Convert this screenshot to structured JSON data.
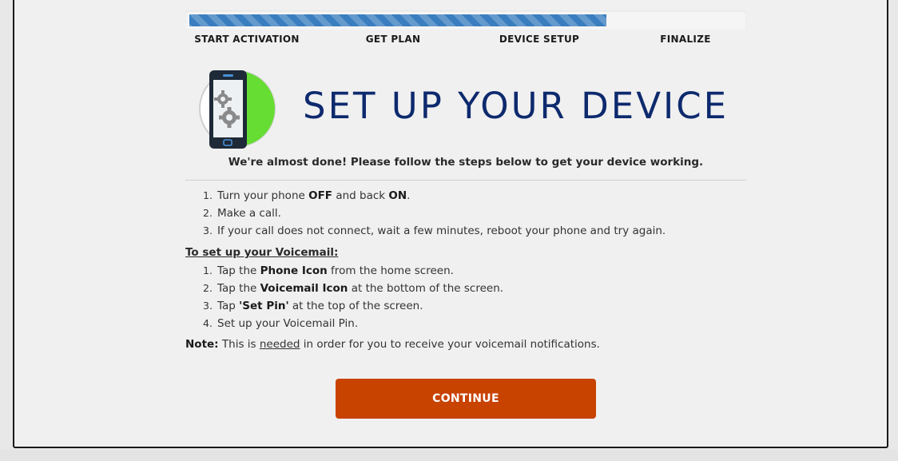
{
  "progress": {
    "fraction": 0.744,
    "steps": [
      "START ACTIVATION",
      "GET PLAN",
      "DEVICE SETUP",
      "FINALIZE"
    ],
    "accent_color": "#3a7ebf"
  },
  "header": {
    "icon": "phone-settings-icon",
    "title": "SET UP YOUR DEVICE",
    "title_color": "#0e2a6e",
    "subtitle": "We're almost done! Please follow the steps below to get your device working."
  },
  "main_steps": [
    {
      "num": "1.",
      "parts": [
        {
          "t": "Turn your phone "
        },
        {
          "t": "OFF",
          "b": true
        },
        {
          "t": " and back "
        },
        {
          "t": "ON",
          "b": true
        },
        {
          "t": "."
        }
      ]
    },
    {
      "num": "2.",
      "parts": [
        {
          "t": "Make a call."
        }
      ]
    },
    {
      "num": "3.",
      "parts": [
        {
          "t": "If your call does not connect, wait a few minutes, reboot your phone and try again."
        }
      ]
    }
  ],
  "voicemail": {
    "heading": "To set up your Voicemail:",
    "steps": [
      {
        "num": "1.",
        "parts": [
          {
            "t": "Tap the "
          },
          {
            "t": "Phone Icon",
            "b": true
          },
          {
            "t": " from the home screen."
          }
        ]
      },
      {
        "num": "2.",
        "parts": [
          {
            "t": "Tap the "
          },
          {
            "t": "Voicemail Icon",
            "b": true
          },
          {
            "t": " at the bottom of the screen."
          }
        ]
      },
      {
        "num": "3.",
        "parts": [
          {
            "t": "Tap "
          },
          {
            "t": "'Set Pin'",
            "b": true
          },
          {
            "t": " at the top of the screen."
          }
        ]
      },
      {
        "num": "4.",
        "parts": [
          {
            "t": "Set up your Voicemail Pin."
          }
        ]
      }
    ]
  },
  "note": {
    "label": "Note:",
    "before": " This is ",
    "underlined": "needed",
    "after": " in order for you to receive your voicemail notifications."
  },
  "continue_button": {
    "label": "CONTINUE",
    "color": "#c84200"
  }
}
